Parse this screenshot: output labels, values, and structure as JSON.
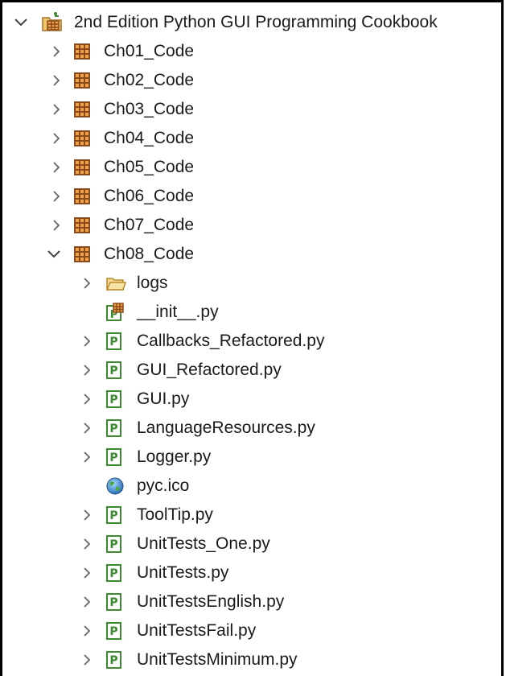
{
  "tree": {
    "root": {
      "label": "2nd Edition Python GUI Programming Cookbook",
      "expanded": true,
      "icon": "python-project-icon"
    },
    "chapters": [
      {
        "label": "Ch01_Code",
        "expanded": false,
        "icon": "package-icon"
      },
      {
        "label": "Ch02_Code",
        "expanded": false,
        "icon": "package-icon"
      },
      {
        "label": "Ch03_Code",
        "expanded": false,
        "icon": "package-icon"
      },
      {
        "label": "Ch04_Code",
        "expanded": false,
        "icon": "package-icon"
      },
      {
        "label": "Ch05_Code",
        "expanded": false,
        "icon": "package-icon"
      },
      {
        "label": "Ch06_Code",
        "expanded": false,
        "icon": "package-icon"
      },
      {
        "label": "Ch07_Code",
        "expanded": false,
        "icon": "package-icon"
      },
      {
        "label": "Ch08_Code",
        "expanded": true,
        "icon": "package-icon"
      }
    ],
    "ch08_children": [
      {
        "label": "logs",
        "type": "folder",
        "icon": "folder-icon",
        "twisty": true
      },
      {
        "label": "__init__.py",
        "type": "init",
        "icon": "init-python-file-icon",
        "twisty": false
      },
      {
        "label": "Callbacks_Refactored.py",
        "type": "py",
        "icon": "python-file-icon",
        "twisty": true
      },
      {
        "label": "GUI_Refactored.py",
        "type": "py",
        "icon": "python-file-icon",
        "twisty": true
      },
      {
        "label": "GUI.py",
        "type": "py",
        "icon": "python-file-icon",
        "twisty": true
      },
      {
        "label": "LanguageResources.py",
        "type": "py",
        "icon": "python-file-icon",
        "twisty": true
      },
      {
        "label": "Logger.py",
        "type": "py",
        "icon": "python-file-icon",
        "twisty": true
      },
      {
        "label": "pyc.ico",
        "type": "ico",
        "icon": "globe-icon",
        "twisty": false
      },
      {
        "label": "ToolTip.py",
        "type": "py",
        "icon": "python-file-icon",
        "twisty": true
      },
      {
        "label": "UnitTests_One.py",
        "type": "py",
        "icon": "python-file-icon",
        "twisty": true
      },
      {
        "label": "UnitTests.py",
        "type": "py",
        "icon": "python-file-icon",
        "twisty": true
      },
      {
        "label": "UnitTestsEnglish.py",
        "type": "py",
        "icon": "python-file-icon",
        "twisty": true
      },
      {
        "label": "UnitTestsFail.py",
        "type": "py",
        "icon": "python-file-icon",
        "twisty": true
      },
      {
        "label": "UnitTestsMinimum.py",
        "type": "py",
        "icon": "python-file-icon",
        "twisty": true
      }
    ]
  },
  "colors": {
    "twisty": "#555555",
    "package_brown": "#8b4a1a",
    "package_orange": "#e07a1a",
    "python_green": "#3c8a2e",
    "folder_yellow": "#e8b84a"
  }
}
